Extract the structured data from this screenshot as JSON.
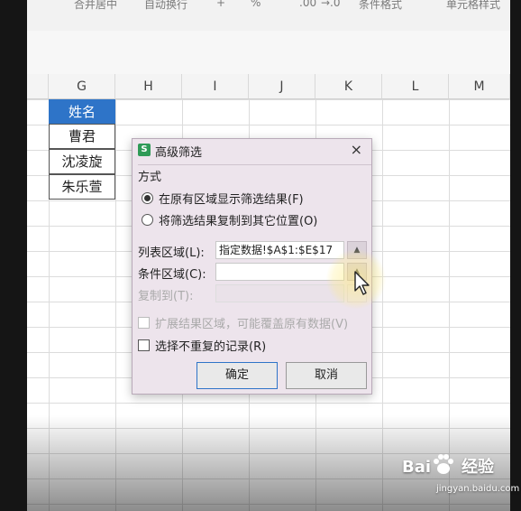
{
  "ribbon": {
    "merge_center": "合并居中",
    "wrap_text": "自动换行",
    "plus": "+",
    "percent": "%",
    "decimal": ".00",
    "decimal_arrow": "→.0",
    "conditional_format": "条件格式",
    "cell_style": "单元格样式"
  },
  "columns": [
    "G",
    "H",
    "I",
    "J",
    "K",
    "L",
    "M"
  ],
  "cells": {
    "header": "姓名",
    "rows": [
      "曹君",
      "沈凌旋",
      "朱乐萱"
    ]
  },
  "dialog": {
    "icon_letter": "S",
    "title": "高级筛选",
    "close": "×",
    "method_label": "方式",
    "option_in_place": "在原有区域显示筛选结果(F)",
    "option_copy": "将筛选结果复制到其它位置(O)",
    "list_range_label": "列表区域(L):",
    "list_range_value": "指定数据!$A$1:$E$17",
    "criteria_range_label": "条件区域(C):",
    "criteria_range_value": "",
    "copy_to_label": "复制到(T):",
    "copy_to_value": "",
    "expand_label": "扩展结果区域，可能覆盖原有数据(V)",
    "unique_label": "选择不重复的记录(R)",
    "ok_label": "确定",
    "cancel_label": "取消"
  },
  "watermark": {
    "brand": "Bai",
    "brand_suffix": "经验",
    "url": "jingyan.baidu.com"
  },
  "colors": {
    "accent": "#2e74c8",
    "dialog_bg": "#ede4ec",
    "app_icon": "#2f9a57"
  }
}
